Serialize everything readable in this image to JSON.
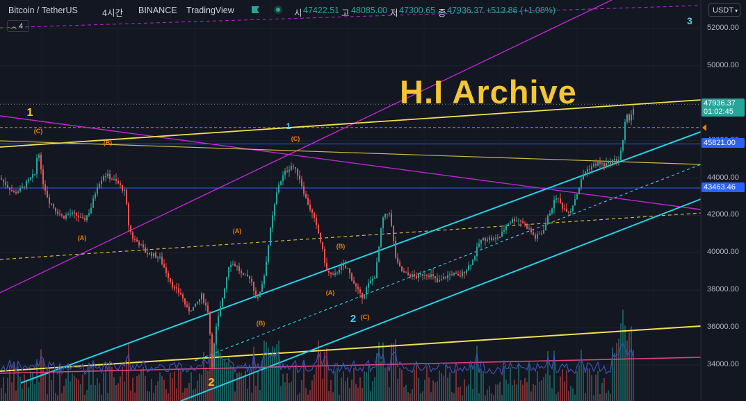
{
  "header": {
    "symbol": "Bitcoin / TetherUS",
    "interval": "4시간",
    "exchange": "BINANCE",
    "source": "TradingView",
    "open_label": "시",
    "open": "47422.51",
    "high_label": "고",
    "high": "48085.00",
    "low_label": "저",
    "low": "47300.65",
    "close_label": "종",
    "close": "47936.37",
    "change": "+513.86 (+1.08%)",
    "indicator_count": "4",
    "currency": "USDT"
  },
  "watermark": "H.I Archive",
  "colors": {
    "background": "#131722",
    "up": "#26a69a",
    "down": "#ef5350",
    "yellow": "#f4e04d",
    "cyan": "#22d3e6",
    "magenta": "#c026d3",
    "blue": "#2962ff",
    "orange": "#f57c00",
    "pink": "#ec407a"
  },
  "chart_data": {
    "type": "candlestick",
    "symbol": "BTCUSDT",
    "ylim": [
      32500,
      53000
    ],
    "y_ticks": [
      34000,
      36000,
      38000,
      40000,
      42000,
      44000,
      46000,
      48000,
      50000,
      52000
    ],
    "y_tick_labels": [
      "34000.00",
      "36000.00",
      "38000.00",
      "40000.00",
      "42000.00",
      "44000.00",
      "46000.00",
      "48000.00",
      "50000.00",
      "52000.00"
    ],
    "price_labels": [
      {
        "value": 47936.37,
        "text": "47936.37",
        "sub": "01:02:45",
        "color": "#26a69a"
      },
      {
        "value": 45821.0,
        "text": "45821.00",
        "color": "#2962ff"
      },
      {
        "value": 43463.46,
        "text": "43463.46",
        "color": "#2962ff"
      }
    ],
    "horizontal_lines": [
      {
        "value": 45821,
        "color": "#2962ff",
        "style": "solid"
      },
      {
        "value": 43463.46,
        "color": "#2962ff",
        "style": "solid"
      },
      {
        "value": 46700,
        "color": "#f57c00",
        "style": "dashed"
      },
      {
        "value": 47940,
        "color": "#787b86",
        "style": "dotted"
      }
    ],
    "close_path": [
      [
        0,
        44000
      ],
      [
        10,
        43600
      ],
      [
        20,
        43200
      ],
      [
        30,
        43400
      ],
      [
        40,
        43800
      ],
      [
        50,
        44200
      ],
      [
        55,
        45700
      ],
      [
        60,
        44000
      ],
      [
        70,
        42800
      ],
      [
        80,
        42300
      ],
      [
        90,
        41900
      ],
      [
        100,
        42100
      ],
      [
        110,
        42000
      ],
      [
        120,
        41700
      ],
      [
        130,
        42300
      ],
      [
        140,
        43600
      ],
      [
        150,
        44200
      ],
      [
        160,
        44000
      ],
      [
        170,
        43700
      ],
      [
        180,
        43200
      ],
      [
        185,
        41500
      ],
      [
        190,
        40800
      ],
      [
        200,
        40500
      ],
      [
        210,
        40000
      ],
      [
        220,
        39900
      ],
      [
        230,
        39700
      ],
      [
        240,
        38900
      ],
      [
        250,
        38100
      ],
      [
        260,
        37800
      ],
      [
        270,
        36900
      ],
      [
        280,
        37100
      ],
      [
        290,
        37700
      ],
      [
        300,
        36800
      ],
      [
        305,
        34000
      ],
      [
        310,
        35800
      ],
      [
        320,
        37600
      ],
      [
        330,
        39500
      ],
      [
        340,
        39300
      ],
      [
        350,
        38700
      ],
      [
        360,
        38700
      ],
      [
        370,
        37400
      ],
      [
        380,
        38800
      ],
      [
        390,
        41500
      ],
      [
        400,
        43600
      ],
      [
        410,
        44300
      ],
      [
        420,
        44700
      ],
      [
        430,
        44100
      ],
      [
        440,
        42900
      ],
      [
        450,
        42000
      ],
      [
        460,
        40800
      ],
      [
        470,
        39000
      ],
      [
        480,
        38700
      ],
      [
        490,
        39300
      ],
      [
        500,
        39100
      ],
      [
        510,
        38300
      ],
      [
        520,
        37600
      ],
      [
        530,
        38300
      ],
      [
        540,
        38800
      ],
      [
        550,
        41800
      ],
      [
        560,
        42200
      ],
      [
        570,
        39500
      ],
      [
        580,
        38900
      ],
      [
        590,
        38800
      ],
      [
        600,
        38700
      ],
      [
        610,
        38900
      ],
      [
        620,
        38800
      ],
      [
        630,
        38400
      ],
      [
        640,
        38700
      ],
      [
        650,
        38900
      ],
      [
        660,
        38700
      ],
      [
        670,
        39100
      ],
      [
        680,
        39600
      ],
      [
        690,
        40600
      ],
      [
        700,
        40800
      ],
      [
        710,
        40700
      ],
      [
        720,
        40900
      ],
      [
        730,
        41600
      ],
      [
        740,
        41800
      ],
      [
        750,
        41700
      ],
      [
        760,
        41300
      ],
      [
        770,
        40800
      ],
      [
        780,
        41100
      ],
      [
        790,
        42100
      ],
      [
        800,
        43000
      ],
      [
        810,
        42400
      ],
      [
        820,
        42200
      ],
      [
        830,
        43200
      ],
      [
        840,
        44300
      ],
      [
        850,
        44600
      ],
      [
        860,
        44800
      ],
      [
        870,
        44700
      ],
      [
        880,
        44900
      ],
      [
        890,
        45000
      ],
      [
        897,
        46100
      ],
      [
        900,
        47300
      ],
      [
        905,
        47200
      ],
      [
        910,
        47600
      ],
      [
        913,
        47936
      ]
    ],
    "wave_labels": [
      {
        "text": "1",
        "color": "#f4c534",
        "x": 43,
        "y": 167,
        "size": 16
      },
      {
        "text": "(C)",
        "color": "#f57c00",
        "x": 55,
        "y": 192,
        "size": 9
      },
      {
        "text": "(B)",
        "color": "#f57c00",
        "x": 155,
        "y": 209,
        "size": 9
      },
      {
        "text": "(A)",
        "color": "#f57c00",
        "x": 118,
        "y": 346,
        "size": 9
      },
      {
        "text": "1",
        "color": "#4dd0e1",
        "x": 415,
        "y": 186,
        "size": 12
      },
      {
        "text": "(C)",
        "color": "#f57c00",
        "x": 425,
        "y": 203,
        "size": 9
      },
      {
        "text": "(A)",
        "color": "#f57c00",
        "x": 341,
        "y": 336,
        "size": 9
      },
      {
        "text": "(B)",
        "color": "#f57c00",
        "x": 490,
        "y": 358,
        "size": 9
      },
      {
        "text": "(A)",
        "color": "#f57c00",
        "x": 475,
        "y": 425,
        "size": 9
      },
      {
        "text": "(B)",
        "color": "#f57c00",
        "x": 375,
        "y": 469,
        "size": 9
      },
      {
        "text": "2",
        "color": "#4dd0e1",
        "x": 508,
        "y": 464,
        "size": 15
      },
      {
        "text": "(C)",
        "color": "#f57c00",
        "x": 525,
        "y": 460,
        "size": 9
      },
      {
        "text": "2",
        "color": "#f4c534",
        "x": 304,
        "y": 556,
        "size": 16
      },
      {
        "text": "3",
        "color": "#4dd0e1",
        "x": 992,
        "y": 35,
        "size": 14
      }
    ]
  }
}
